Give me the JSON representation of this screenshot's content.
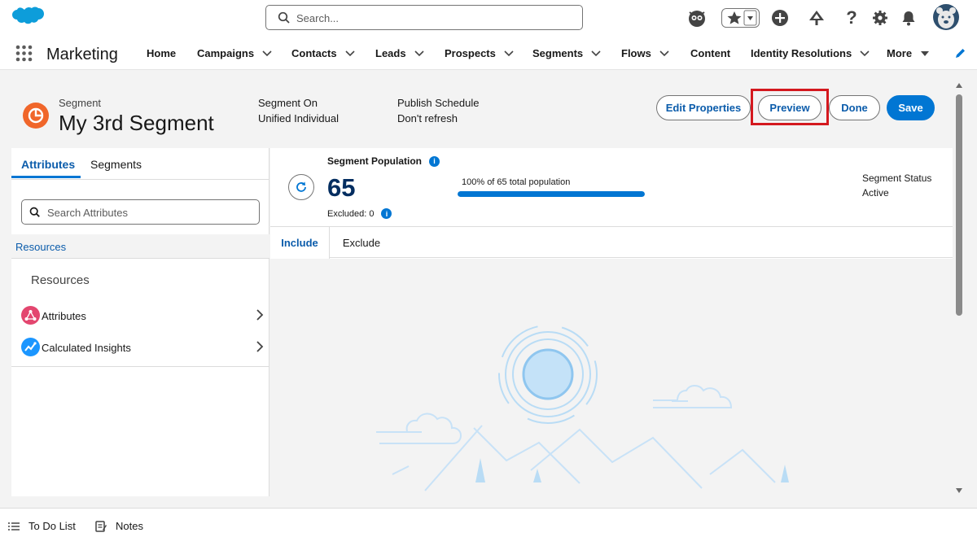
{
  "topbar": {
    "search_placeholder": "Search...",
    "utility_icons": [
      "astro-avatar-icon",
      "favorites-star-icon",
      "global-actions-plus-icon",
      "trailhead-icon",
      "help-icon",
      "setup-gear-icon",
      "notifications-bell-icon",
      "user-avatar-icon"
    ]
  },
  "nav": {
    "app_name": "Marketing",
    "items": [
      {
        "label": "Home",
        "has_menu": false
      },
      {
        "label": "Campaigns",
        "has_menu": true
      },
      {
        "label": "Contacts",
        "has_menu": true
      },
      {
        "label": "Leads",
        "has_menu": true
      },
      {
        "label": "Prospects",
        "has_menu": true
      },
      {
        "label": "Segments",
        "has_menu": true
      },
      {
        "label": "Flows",
        "has_menu": true
      },
      {
        "label": "Content",
        "has_menu": false
      },
      {
        "label": "Identity Resolutions",
        "has_menu": true
      },
      {
        "label": "More",
        "has_menu": true
      }
    ]
  },
  "header": {
    "object_label": "Segment",
    "title": "My 3rd Segment",
    "segment_on_label": "Segment On",
    "segment_on_value": "Unified Individual",
    "publish_label": "Publish Schedule",
    "publish_value": "Don't refresh",
    "buttons": {
      "edit_properties": "Edit Properties",
      "preview": "Preview",
      "done": "Done",
      "save": "Save"
    }
  },
  "left_panel": {
    "tabs": [
      "Attributes",
      "Segments"
    ],
    "active_tab": "Attributes",
    "search_placeholder": "Search Attributes",
    "breadcrumb": "Resources",
    "section_title": "Resources",
    "items": [
      {
        "label": "Attributes",
        "icon": "attributes-icon"
      },
      {
        "label": "Calculated Insights",
        "icon": "calculated-insights-icon"
      }
    ]
  },
  "population": {
    "label": "Segment Population",
    "count": "65",
    "excluded": "Excluded: 0",
    "percent_text": "100% of 65 total population",
    "progress_percent": 100,
    "status_label": "Segment Status",
    "status_value": "Active"
  },
  "rule_tabs": [
    "Include",
    "Exclude"
  ],
  "footer": {
    "todo": "To Do List",
    "notes": "Notes"
  },
  "colors": {
    "brand": "#0176d3",
    "highlight": "#d4181e",
    "segment_icon": "#f0662a"
  }
}
